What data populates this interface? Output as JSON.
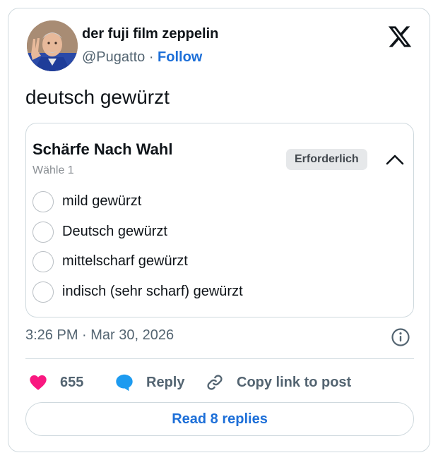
{
  "author": {
    "display_name": "der fuji film zeppelin",
    "handle": "@Pugatto",
    "separator": "·",
    "follow_label": "Follow"
  },
  "tweet": {
    "text": "deutsch gewürzt",
    "timestamp": "3:26 PM · Mar 30, 2026"
  },
  "poll": {
    "title": "Schärfe Nach Wahl",
    "subtitle": "Wähle 1",
    "badge": "Erforderlich",
    "options": [
      {
        "label": "mild gewürzt"
      },
      {
        "label": "Deutsch gewürzt"
      },
      {
        "label": "mittelscharf gewürzt"
      },
      {
        "label": "indisch (sehr scharf) gewürzt"
      }
    ]
  },
  "actions": {
    "like_count": "655",
    "reply_label": "Reply",
    "copy_link_label": "Copy link to post"
  },
  "read_replies_label": "Read 8 replies",
  "icons": {
    "brand": "x-logo-icon",
    "like": "heart-icon",
    "reply": "speech-bubble-icon",
    "copy": "link-icon",
    "info": "info-icon",
    "collapse": "chevron-up-icon"
  },
  "colors": {
    "heart": "#f91880",
    "reply_bubble": "#1d9bf0",
    "link_blue": "#1d6fd8",
    "muted_text": "#536471",
    "border": "#cfd9de",
    "badge_bg": "#e6e8ea"
  }
}
